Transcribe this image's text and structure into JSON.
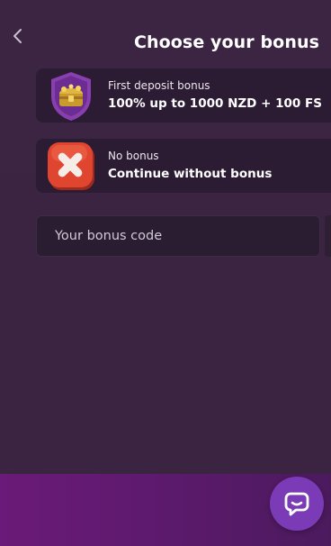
{
  "header": {
    "title": "Choose your bonus",
    "back_icon": "chevron-left-icon"
  },
  "bonuses": [
    {
      "label": "First deposit bonus",
      "value": "100% up to 1000 NZD + 100 FS",
      "icon": "treasure-shield-icon"
    },
    {
      "label": "No bonus",
      "value": "Continue without bonus",
      "icon": "red-x-icon"
    }
  ],
  "bonus_code": {
    "placeholder": "Your bonus code",
    "value": ""
  },
  "chat": {
    "icon": "chat-bubble-icon"
  },
  "colors": {
    "background": "#3a2542",
    "card": "#2c1c33",
    "footer": "#6a1a78",
    "chat_button": "#7b3bb6",
    "x_red": "#e0462f"
  }
}
